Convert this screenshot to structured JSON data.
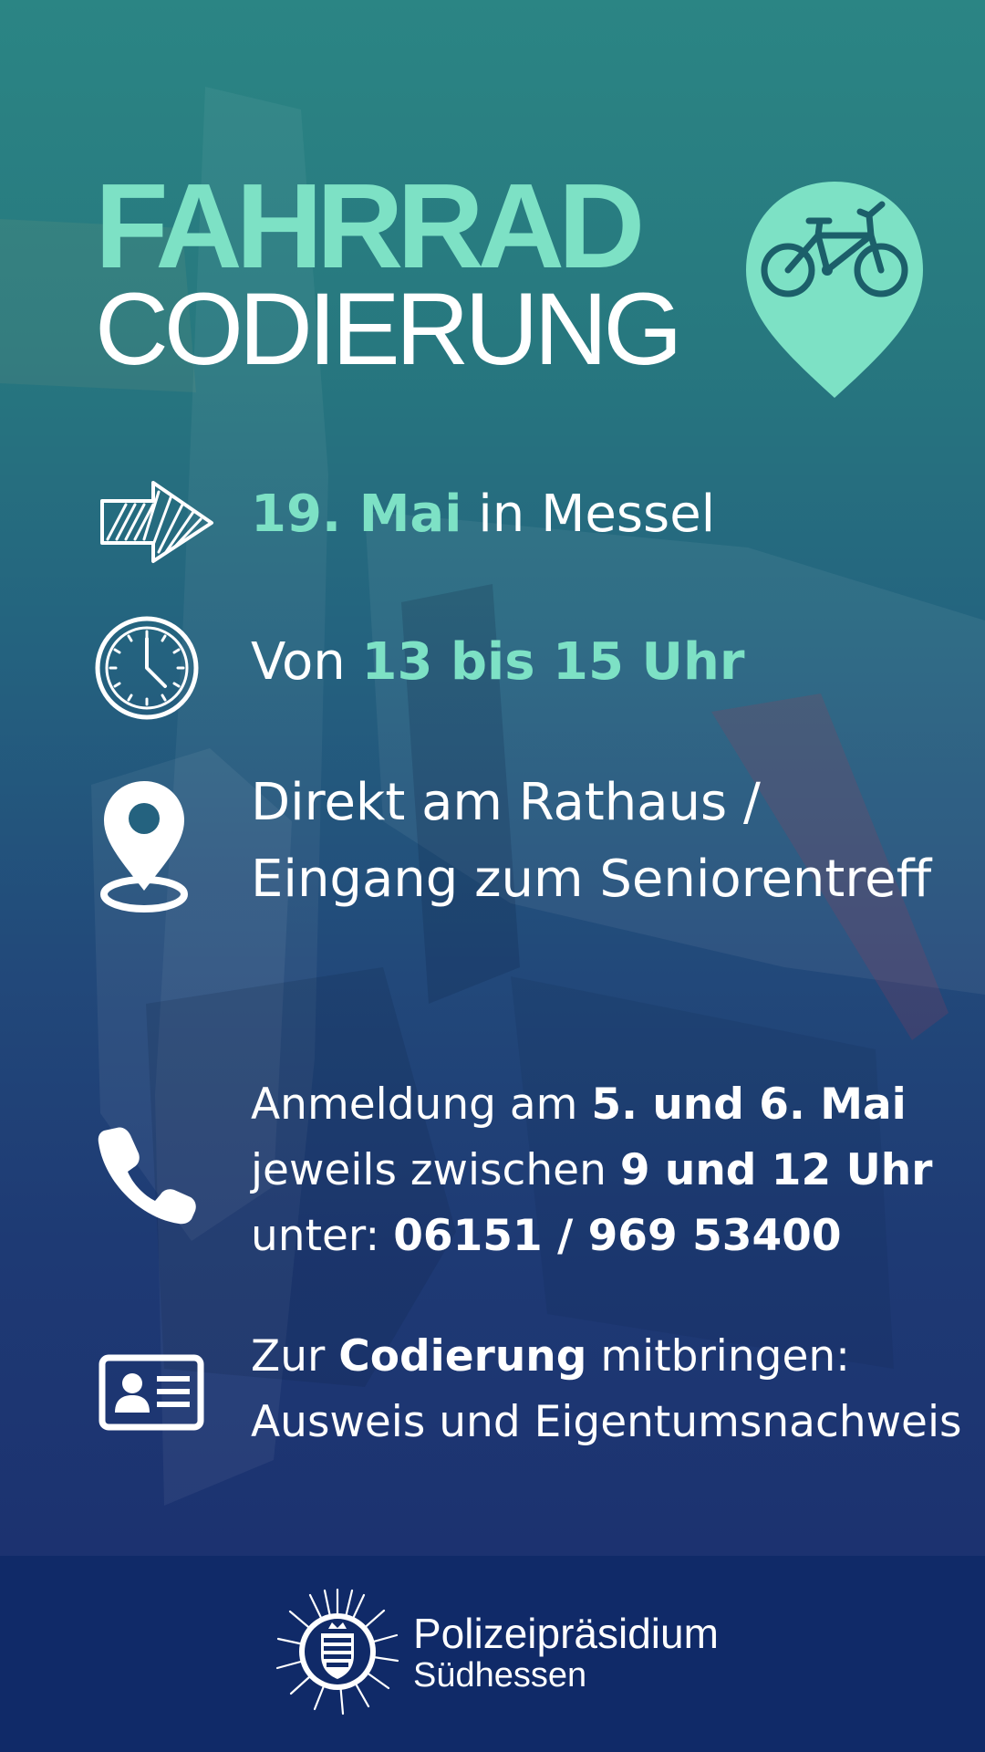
{
  "title": {
    "line1": "FAHRRAD",
    "line2": "CODIERUNG",
    "badge_icon": "bicycle-icon"
  },
  "colors": {
    "accent": "#7de1c5",
    "text": "#ffffff",
    "footer_bg": "#102a68"
  },
  "rows": {
    "date": {
      "icon": "arrow-right-icon",
      "part1": "19. Mai",
      "part2": " in Messel"
    },
    "time": {
      "icon": "clock-icon",
      "part1": "Von ",
      "part2": "13 bis 15 Uhr"
    },
    "location": {
      "icon": "location-pin-icon",
      "line1": "Direkt am Rathaus /",
      "line2": "Eingang zum Seniorentreff"
    },
    "registration": {
      "icon": "phone-icon",
      "line1_a": "Anmeldung am ",
      "line1_b": "5. und 6. Mai",
      "line2_a": "jeweils zwischen ",
      "line2_b": "9 und 12 Uhr",
      "line3_a": "unter: ",
      "line3_b": "06151 / 969 53400"
    },
    "bring": {
      "icon": "id-card-icon",
      "line1_a": "Zur ",
      "line1_b": "Codierung",
      "line1_c": " mitbringen:",
      "line2": "Ausweis und Eigentumsnachweis"
    }
  },
  "footer": {
    "logo_icon": "police-star-icon",
    "line1": "Polizeipräsidium",
    "line2": "Südhessen"
  }
}
